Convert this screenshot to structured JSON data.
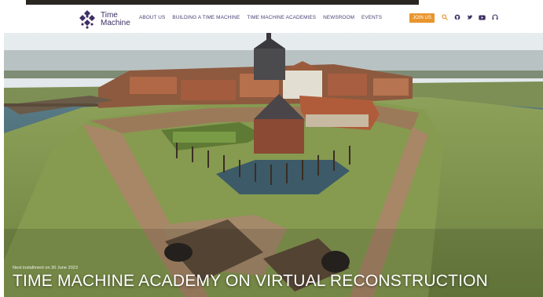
{
  "brand": {
    "line1": "Time",
    "line2": "Machine",
    "logo_color": "#3d2f63"
  },
  "menu": [
    {
      "label": "ABOUT US"
    },
    {
      "label": "BUILDING A TIME MACHINE"
    },
    {
      "label": "TIME MACHINE ACADEMIES"
    },
    {
      "label": "NEWSROOM"
    },
    {
      "label": "EVENTS"
    }
  ],
  "join_label": "JOIN US",
  "accent_color": "#e8962e",
  "icons": [
    "search-icon",
    "github-icon",
    "twitter-icon",
    "youtube-icon",
    "headset-icon"
  ],
  "hero": {
    "subtitle": "Next installment on 30 June 2023",
    "title": "TIME MACHINE ACADEMY ON VIRTUAL RECONSTRUCTION"
  }
}
